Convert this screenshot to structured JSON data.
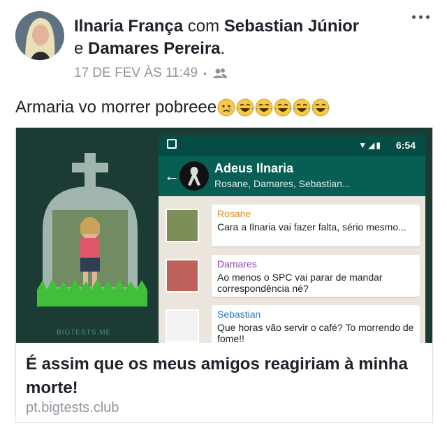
{
  "post": {
    "author": "Ilnaria França",
    "with_word": "com",
    "tagged_1": "Sebastian Júnior",
    "and_word": "e",
    "tagged_2": "Damares Pereira",
    "period": ".",
    "timestamp": "17 DE FEV ÀS 11:49",
    "dot": "•",
    "audience_icon": "friends-icon",
    "text": "Armaria vo morrer pobreee",
    "emojis": [
      "crying-face",
      "laughing-tears-face",
      "laughing-tears-face",
      "laughing-tears-face",
      "laughing-tears-face",
      "laughing-tears-face"
    ]
  },
  "link_card": {
    "title": "É assim que os meus amigos reagiriam à minha morte!",
    "domain": "pt.bigtests.club",
    "image": {
      "status_time": "6:54",
      "group_name": "Adeus Ilnaria",
      "group_members": "Rosane, Damares, Sebastian...",
      "watermark": "BIGTESTS.ME",
      "messages": [
        {
          "sender": "Rosane",
          "sender_color": "#d98b1a",
          "text": "Cara a Ilnaria vai fazer falta, sério mesmo..."
        },
        {
          "sender": "Damares",
          "sender_color": "#8e44ad",
          "text": "Ao menos o SPC vai parar de mandar correspondência né?"
        },
        {
          "sender": "Sebastian",
          "sender_color": "#2a7bbf",
          "text": "Que horas vão servir o café? To morrendo de fome!!"
        }
      ]
    }
  },
  "colors": {
    "whatsapp_dark": "#075e54",
    "card_bg": "#1b3b34",
    "meta_text": "#90949c"
  }
}
